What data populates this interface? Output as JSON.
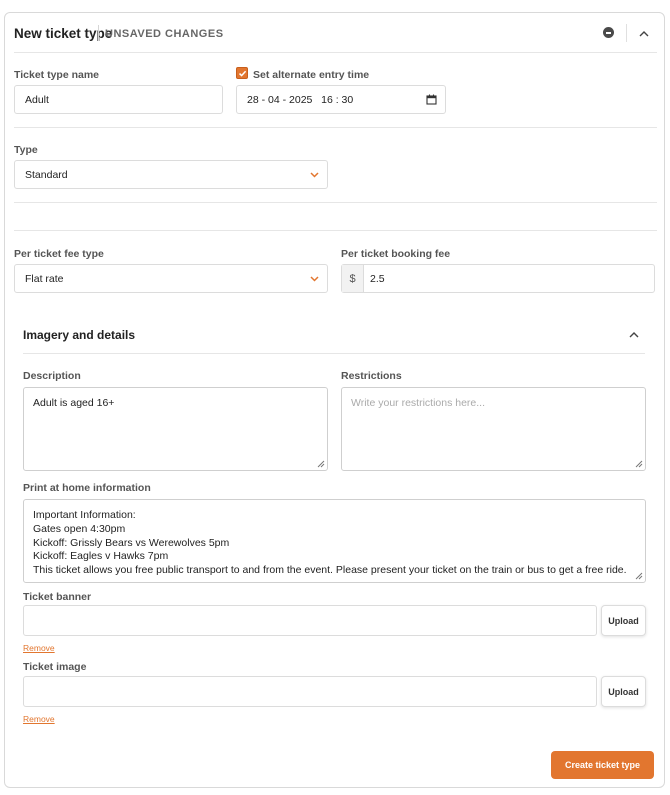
{
  "header": {
    "title": "New ticket type",
    "status": "UNSAVED CHANGES"
  },
  "fields": {
    "name": {
      "label": "Ticket type name",
      "value": "Adult"
    },
    "alt_entry": {
      "label": "Set alternate entry time",
      "checked": true,
      "value": "28 - 04 - 2025   16 : 30"
    },
    "type": {
      "label": "Type",
      "value": "Standard"
    },
    "fee_type": {
      "label": "Per ticket fee type",
      "value": "Flat rate"
    },
    "booking_fee": {
      "label": "Per ticket booking fee",
      "prefix": "$",
      "value": "2.5"
    }
  },
  "imagery": {
    "title": "Imagery and details",
    "description": {
      "label": "Description",
      "value": "Adult is aged 16+"
    },
    "restrictions": {
      "label": "Restrictions",
      "placeholder": "Write your restrictions here..."
    },
    "print_info": {
      "label": "Print at home information",
      "lines": [
        "Important Information:",
        "Gates open 4:30pm",
        "Kickoff: Grissly Bears vs Werewolves 5pm",
        "Kickoff: Eagles v Hawks 7pm",
        "This ticket allows you free public transport to and from the event. Please present your ticket on the train or bus to get a free ride."
      ]
    },
    "banner": {
      "label": "Ticket banner",
      "upload_label": "Upload",
      "remove_label": "Remove"
    },
    "image": {
      "label": "Ticket image",
      "upload_label": "Upload",
      "remove_label": "Remove"
    }
  },
  "actions": {
    "create_label": "Create ticket type"
  },
  "colors": {
    "accent": "#e2762f",
    "border": "#dcdcdc",
    "text": "#2b2b2b"
  }
}
